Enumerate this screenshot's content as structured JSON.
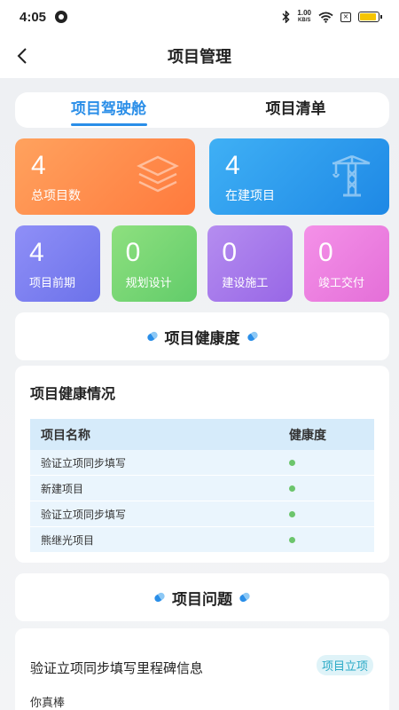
{
  "status": {
    "time": "4:05",
    "net_speed": "1.00",
    "net_unit": "KB/S",
    "battery_level": 0.9
  },
  "nav": {
    "title": "项目管理"
  },
  "tabs": [
    {
      "label": "项目驾驶舱",
      "active": true
    },
    {
      "label": "项目清单",
      "active": false
    }
  ],
  "big_cards": [
    {
      "value": "4",
      "label": "总项目数",
      "color": "#ff8a4a",
      "icon": "layers-icon"
    },
    {
      "value": "4",
      "label": "在建项目",
      "color": "#2a9bef",
      "icon": "crane-icon"
    }
  ],
  "small_cards": [
    {
      "value": "4",
      "label": "项目前期",
      "color": "#7b80ef"
    },
    {
      "value": "0",
      "label": "规划设计",
      "color": "#74d674"
    },
    {
      "value": "0",
      "label": "建设施工",
      "color": "#a676ea"
    },
    {
      "value": "0",
      "label": "竣工交付",
      "color": "#ec7fde"
    }
  ],
  "health_section": {
    "title": "项目健康度",
    "subtitle": "项目健康情况",
    "columns": [
      "项目名称",
      "健康度"
    ],
    "rows": [
      {
        "name": "验证立项同步填写",
        "status_color": "#6cc56c"
      },
      {
        "name": "新建项目",
        "status_color": "#6cc56c"
      },
      {
        "name": "验证立项同步填写",
        "status_color": "#6cc56c"
      },
      {
        "name": "熊继光项目",
        "status_color": "#6cc56c"
      }
    ]
  },
  "issues_section": {
    "title": "项目问题",
    "items": [
      {
        "title": "验证立项同步填写里程碑信息",
        "tag": "项目立项",
        "desc": "你真棒"
      }
    ]
  }
}
